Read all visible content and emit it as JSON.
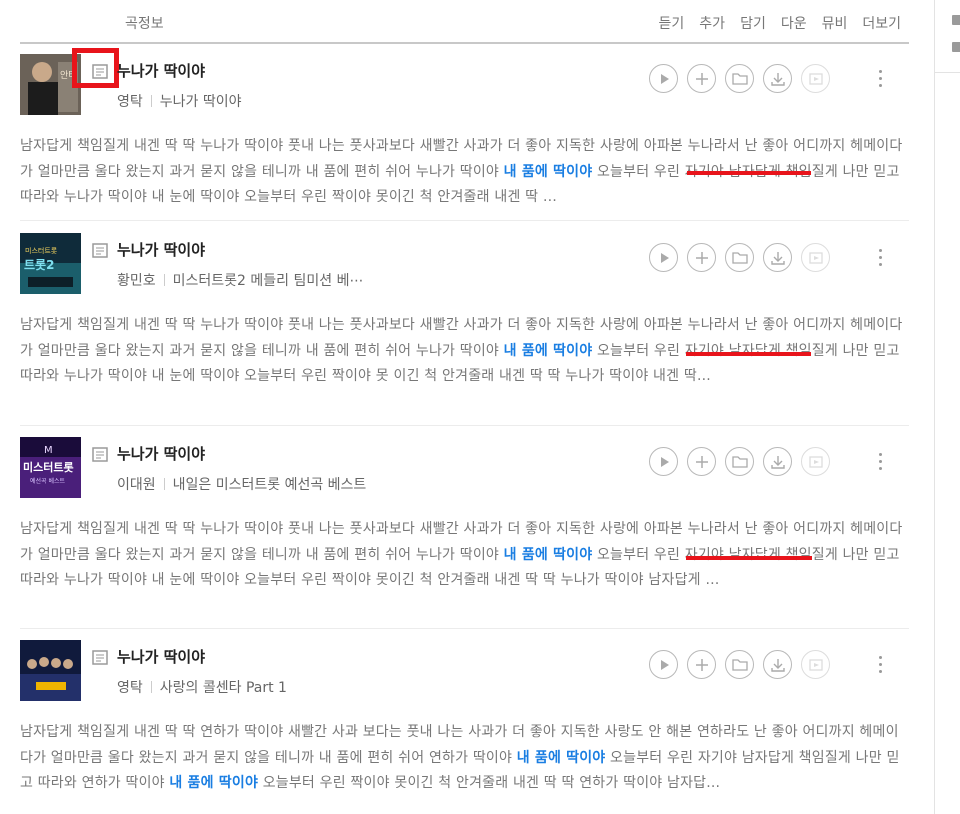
{
  "header": {
    "info_label": "곡정보",
    "actions": [
      "듣기",
      "추가",
      "담기",
      "다운",
      "뮤비",
      "더보기"
    ]
  },
  "colors": {
    "accent_blue": "#1a7ee2",
    "highlight_red": "#e8141b"
  },
  "songs": [
    {
      "title": "누나가 딱이야",
      "artist": "영탁",
      "album": "누나가 딱이야",
      "lyric_parts": [
        "남자답게 책임질게 내겐 딱 딱 누나가 딱이야 풋내 나는 풋사과보다 새빨간 사과가 더 좋아 지독한 사랑에 아파본 누나라서 난 좋아 어디까지 헤메이다가 얼마만큼 울다 왔는지 과거 묻지 않을 테니까 내 품에 편히 쉬어 누나가 딱이야 ",
        "내 품에 딱이야",
        " 오늘부터 우린 자기야 남자답게 책임질게 나만 믿고 따라와 누나가 딱이야 내 눈에 딱이야 오늘부터 우린 짝이야 못이긴 척 안겨줄래 내겐 딱 …"
      ]
    },
    {
      "title": "누나가 딱이야",
      "artist": "황민호",
      "album": "미스터트롯2 메들리 팀미션 베⋯",
      "lyric_parts": [
        "남자답게 책임질게 내겐 딱 딱 누나가 딱이야 풋내 나는 풋사과보다 새빨간 사과가 더 좋아 지독한 사랑에 아파본 누나라서 난 좋아 어디까지 헤메이다가 얼마만큼 울다 왔는지 과거 묻지 않을 테니까 내 품에 편히 쉬어 누나가 딱이야 ",
        "내 품에 딱이야",
        " 오늘부터 우린 자기야 남자답게 책임질게 나만 믿고 따라와 누나가 딱이야 내 눈에 딱이야 오늘부터 우린 짝이야 못 이긴 척 안겨줄래 내겐 딱 딱 누나가 딱이야 내겐 딱..."
      ]
    },
    {
      "title": "누나가 딱이야",
      "artist": "이대원",
      "album": "내일은 미스터트롯 예선곡 베스트",
      "lyric_parts": [
        "남자답게 책임질게 내겐 딱 딱 누나가 딱이야 풋내 나는 풋사과보다 새빨간 사과가 더 좋아 지독한 사랑에 아파본 누나라서 난 좋아 어디까지 헤메이다가 얼마만큼 울다 왔는지 과거 묻지 않을 테니까 내 품에 편히 쉬어 누나가 딱이야 ",
        "내 품에 딱이야",
        " 오늘부터 우린 자기야 남자답게 책임질게 나만 믿고 따라와 누나가 딱이야 내 눈에 딱이야 오늘부터 우린 짝이야 못이긴 척 안겨줄래 내겐 딱 딱 누나가 딱이야 남자답게 …"
      ]
    },
    {
      "title": "누나가 딱이야",
      "artist": "영탁",
      "album": "사랑의 콜센타 Part 1",
      "lyric_parts": [
        "남자답게 책임질게 내겐 딱 딱 연하가 딱이야 새빨간 사과 보다는 풋내 나는 사과가 더 좋아 지독한 사랑도 안 해본 연하라도 난 좋아 어디까지 헤메이다가 얼마만큼 울다 왔는지 과거 묻지 않을 테니까 내 품에 편히 쉬어 연하가 딱이야 ",
        "내 품에 딱이야",
        " 오늘부터 우린 자기야 남자답게 책임질게 나만 믿고 따라와 연하가 딱이야 ",
        "내 품에 딱이야",
        " 오늘부터 우린 짝이야 못이긴 척 안겨줄래 내겐 딱 딱 연하가 딱이야 남자답..."
      ]
    }
  ]
}
